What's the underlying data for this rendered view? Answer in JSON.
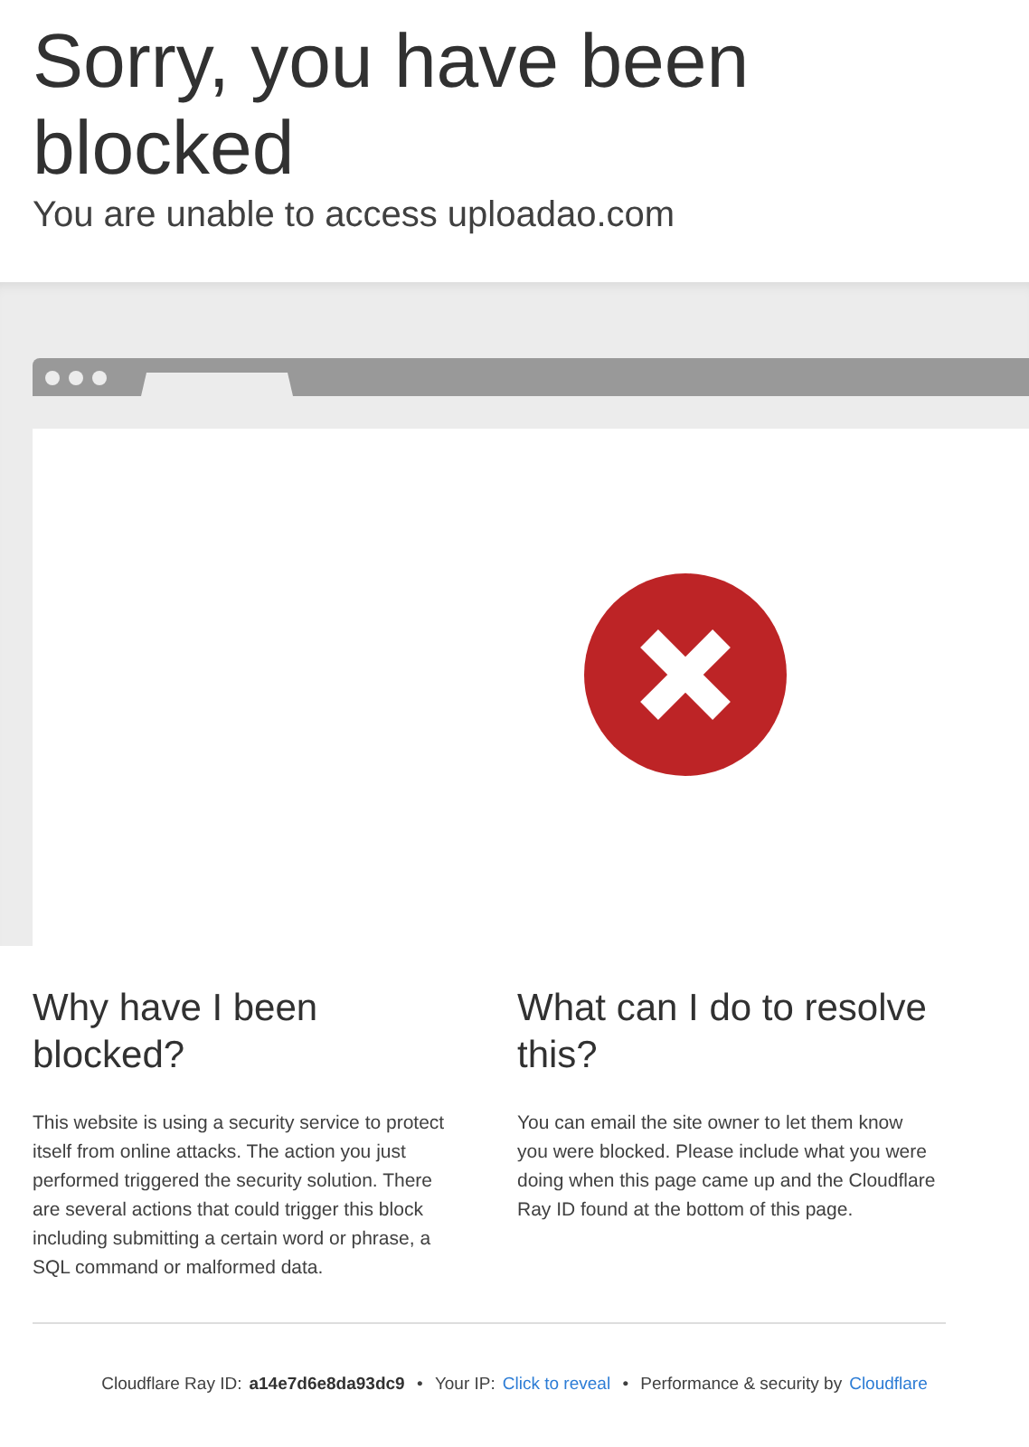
{
  "header": {
    "title": "Sorry, you have been blocked",
    "subtitle": "You are unable to access uploadao.com"
  },
  "sections": [
    {
      "heading": "Why have I been blocked?",
      "body": "This website is using a security service to protect itself from online attacks. The action you just performed triggered the security solution. There are several actions that could trigger this block including submitting a certain word or phrase, a SQL command or malformed data."
    },
    {
      "heading": "What can I do to resolve this?",
      "body": "You can email the site owner to let them know you were blocked. Please include what you were doing when this page came up and the Cloudflare Ray ID found at the bottom of this page."
    }
  ],
  "footer": {
    "ray_label": "Cloudflare Ray ID:",
    "ray_id": "a14e7d6e8da93dc9",
    "separator_1": "•",
    "ip_label": "Your IP:",
    "ip_link": "Click to reveal",
    "separator_2": "•",
    "perf_label": "Performance & security by",
    "perf_link": "Cloudflare"
  }
}
